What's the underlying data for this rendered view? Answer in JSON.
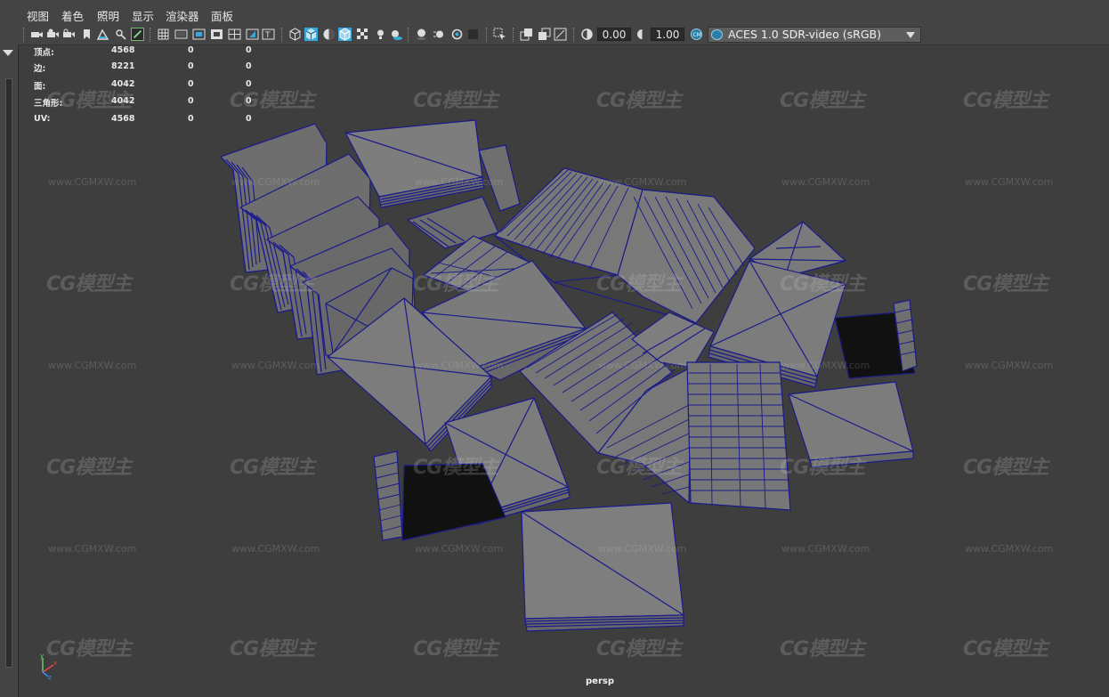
{
  "menu": [
    "视图",
    "着色",
    "照明",
    "显示",
    "渲染器",
    "面板"
  ],
  "toolbar": {
    "exposure_value": "0.00",
    "gamma_value": "1.00",
    "color_space": "ACES 1.0 SDR-video (sRGB)",
    "accent": "#3aa7d8",
    "icons": [
      "select-camera-icon",
      "camera-attrs-icon",
      "bookmark-icon",
      "image-plane-icon",
      "grid-icon",
      "film-gate-icon",
      "resolution-gate-icon",
      "gate-mask-icon",
      "field-chart-icon",
      "safe-action-icon",
      "safe-title-icon",
      "wireframe-icon",
      "smooth-shade-icon",
      "shade-wireframe-icon",
      "xray-icon",
      "textured-icon",
      "use-lights-icon",
      "shadows-icon",
      "screen-space-ao-icon",
      "motion-blur-icon",
      "anti-alias-icon",
      "depth-of-field-icon",
      "isolate-select-icon",
      "xray-joints-icon",
      "xray-active-icon",
      "backface-icon",
      "exposure-icon",
      "gamma-icon",
      "color-manage-icon"
    ]
  },
  "hud": {
    "rows": [
      {
        "label": "顶点:",
        "v1": "4568",
        "v2": "0",
        "v3": "0"
      },
      {
        "label": "边:",
        "v1": "8221",
        "v2": "0",
        "v3": "0"
      },
      {
        "label": "面:",
        "v1": "4042",
        "v2": "0",
        "v3": "0"
      },
      {
        "label": "三角形:",
        "v1": "4042",
        "v2": "0",
        "v3": "0"
      },
      {
        "label": "UV:",
        "v1": "4568",
        "v2": "0",
        "v3": "0"
      }
    ]
  },
  "camera": "persp",
  "axis": {
    "x": "x",
    "y": "y",
    "z": "z"
  },
  "watermark": {
    "logo": "CG模型主",
    "url": "www.CGMXW.com"
  },
  "colors": {
    "wire": "#1a1a8c",
    "mesh": "#7b7b7b",
    "viewport_bg": "#3e3e3e"
  }
}
